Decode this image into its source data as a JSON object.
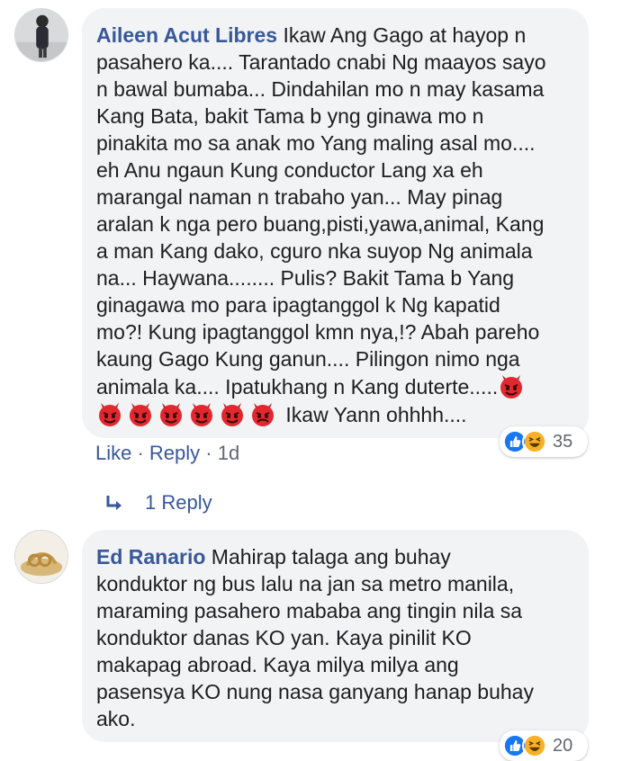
{
  "comments": [
    {
      "author": "Aileen Acut Libres",
      "text": " Ikaw Ang Gago at hayop n\npasahero ka.... Tarantado cnabi Ng maayos sayo\nn bawal bumaba... Dindahilan mo n may kasama\nKang Bata, bakit Tama b yng ginawa mo n\npinakita mo sa anak mo Yang maling asal mo....\neh Anu ngaun Kung conductor Lang xa eh\nmarangal naman n trabaho yan... May pinag\naralan k nga pero buang,pisti,yawa,animal, Kang\na man Kang dako, cguro nka suyop Ng animala\nna... Haywana........ Pulis? Bakit Tama b Yang\nginagawa mo para ipagtanggol k Ng kapatid\nmo?! Kung ipagtanggol kmn nya,!? Abah pareho\nkaung Gago Kung ganun.... Pilingon nimo nga\nanimala ka.... Ipatukhang n Kang duterte.....",
      "text_end": "Ikaw Yann ohhhh....",
      "emoji_icon": "devil-emoji-icon",
      "actions": {
        "like": "Like",
        "sep1": " · ",
        "reply": "Reply",
        "sep2": " · ",
        "time": "1d"
      },
      "reactions": {
        "icons": [
          "like-reaction-icon",
          "haha-reaction-icon"
        ],
        "count": "35"
      },
      "replies_label": "1 Reply"
    },
    {
      "author": "Ed Ranario",
      "text": " Mahirap talaga ang buhay\nkonduktor ng bus lalu na jan sa metro manila,\nmaraming pasahero mababa ang tingin nila sa\nkonduktor danas KO yan. Kaya pinilit KO\nmakapag abroad. Kaya milya milya ang\npasensya KO nung nasa ganyang hanap buhay\nako.",
      "reactions": {
        "icons": [
          "like-reaction-icon",
          "haha-reaction-icon"
        ],
        "count": "20"
      }
    }
  ],
  "colors": {
    "link": "#385898",
    "bubble_bg": "#f2f3f5",
    "text": "#1c1e21",
    "meta": "#606770",
    "like_blue": "#1877f2",
    "haha_yellow": "#f7b125",
    "devil_red": "#e0282e"
  }
}
